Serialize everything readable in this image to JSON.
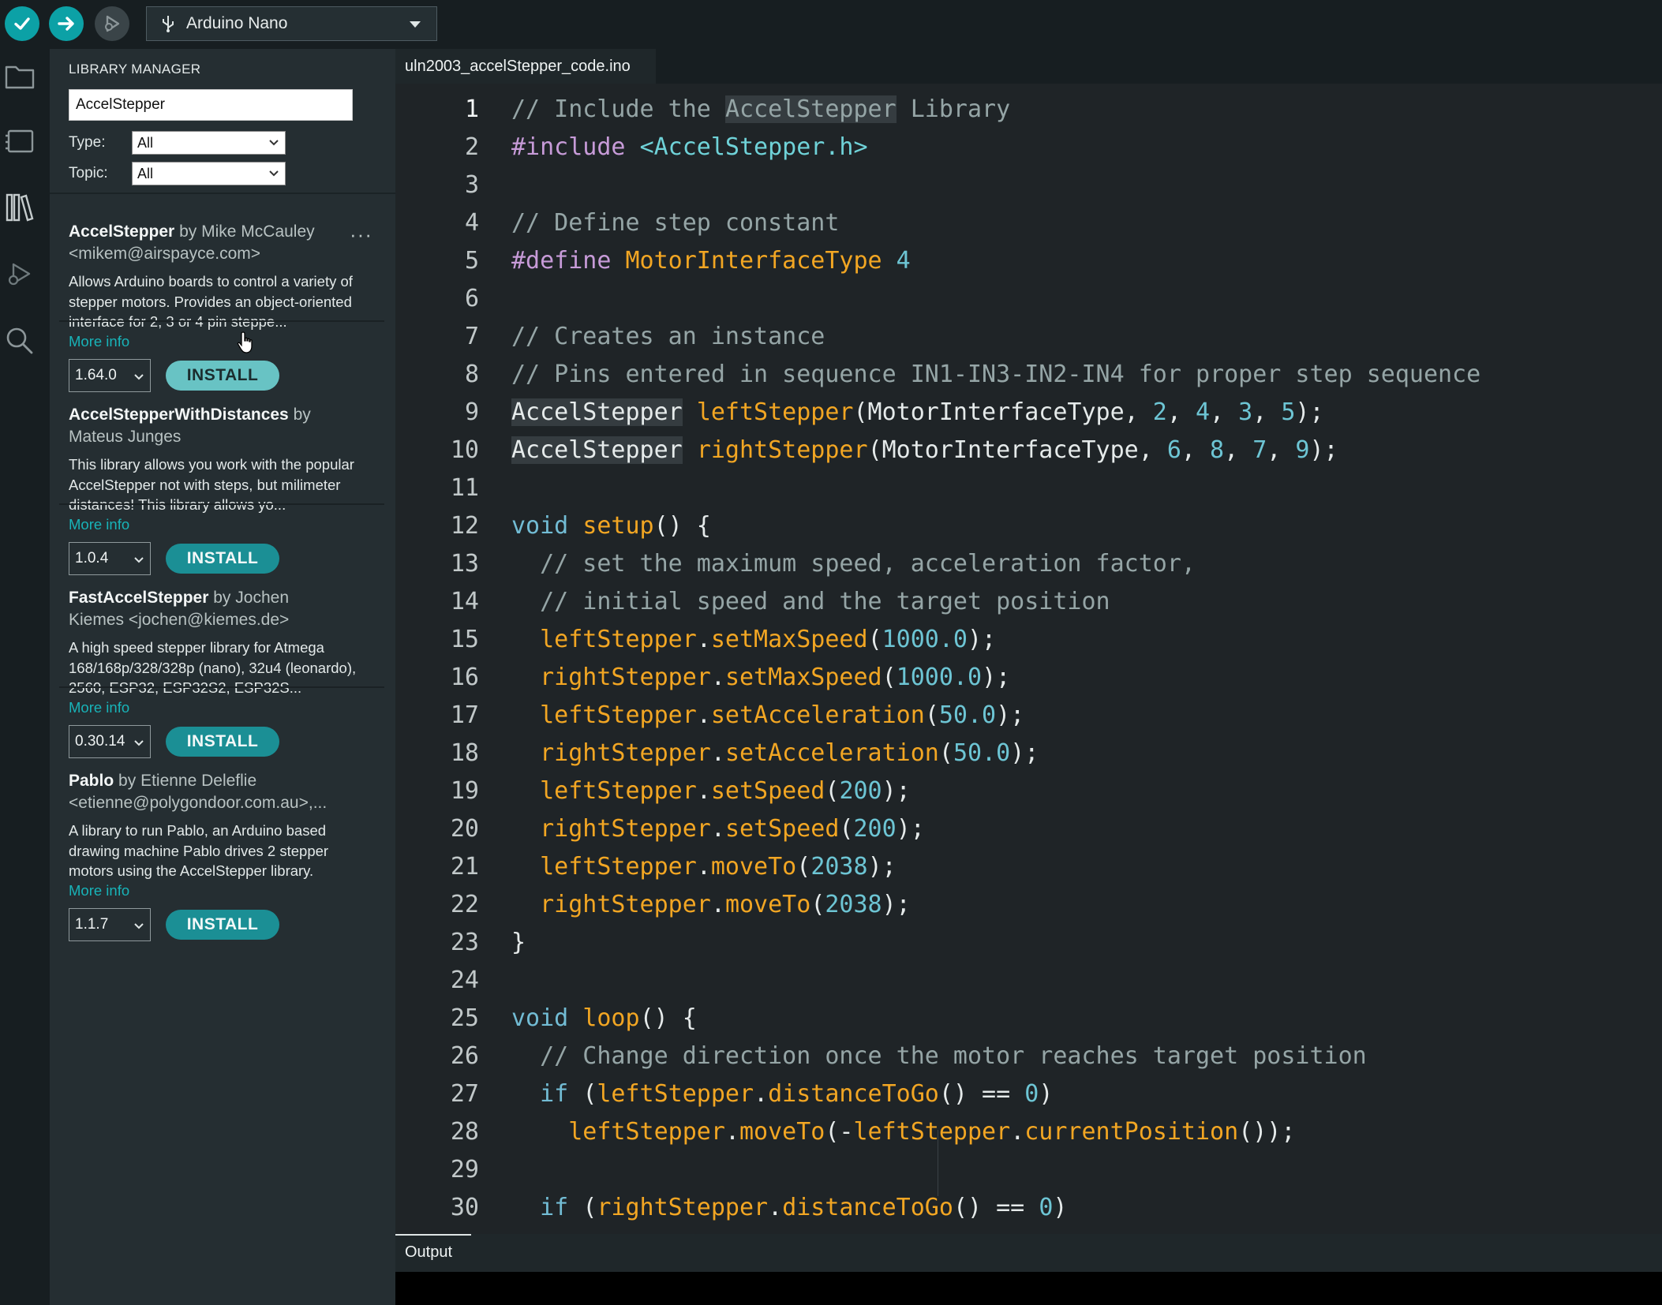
{
  "toolbar": {
    "board": "Arduino Nano"
  },
  "library_manager": {
    "title": "LIBRARY MANAGER",
    "search_value": "AccelStepper",
    "type_label": "Type:",
    "type_value": "All",
    "topic_label": "Topic:",
    "topic_value": "All",
    "libraries": [
      {
        "name": "AccelStepper",
        "by": "by",
        "author": "Mike McCauley",
        "author2": "<mikem@airspayce.com>",
        "description": "Allows Arduino boards to control a variety of stepper motors. Provides an object-oriented interface for 2, 3 or 4 pin steppe...",
        "more_info": "More info",
        "version": "1.64.0",
        "install": "INSTALL"
      },
      {
        "name": "AccelStepperWithDistances",
        "by": "by",
        "author": "",
        "author2": "Mateus Junges",
        "description": "This library allows you work with the popular AccelStepper not with steps, but milimeter distances! This library allows yo...",
        "more_info": "More info",
        "version": "1.0.4",
        "install": "INSTALL"
      },
      {
        "name": "FastAccelStepper",
        "by": "by",
        "author": "Jochen",
        "author2": "Kiemes <jochen@kiemes.de>",
        "description": "A high speed stepper library for Atmega 168/168p/328/328p (nano), 32u4 (leonardo), 2560, ESP32, ESP32S2, ESP32S...",
        "more_info": "More info",
        "version": "0.30.14",
        "install": "INSTALL"
      },
      {
        "name": "Pablo",
        "by": "by",
        "author": "Etienne Deleflie",
        "author2": "<etienne@polygondoor.com.au>,...",
        "description": "A library to run Pablo, an Arduino based drawing machine Pablo drives 2 stepper motors using the AccelStepper library.",
        "more_info": "More info",
        "version": "1.1.7",
        "install": "INSTALL"
      }
    ]
  },
  "editor": {
    "tab": "uln2003_accelStepper_code.ino",
    "lines": [
      [
        [
          "c-com",
          "// Include the "
        ],
        [
          "c-com hl",
          "AccelStepper"
        ],
        [
          "c-com",
          " Library"
        ]
      ],
      [
        [
          "c-pre",
          "#include "
        ],
        [
          "c-inc",
          "<AccelStepper.h>"
        ]
      ],
      [],
      [
        [
          "c-com",
          "// Define step constant"
        ]
      ],
      [
        [
          "c-pre",
          "#define "
        ],
        [
          "c-fn",
          "MotorInterfaceType "
        ],
        [
          "c-num",
          "4"
        ]
      ],
      [],
      [
        [
          "c-com",
          "// Creates an instance"
        ]
      ],
      [
        [
          "c-com",
          "// Pins entered in sequence IN1-IN3-IN2-IN4 for proper step sequence"
        ]
      ],
      [
        [
          "c-typ hl",
          "AccelStepper"
        ],
        [
          "c-op",
          " "
        ],
        [
          "c-fn",
          "leftStepper"
        ],
        [
          "c-op",
          "(MotorInterfaceType, "
        ],
        [
          "c-num",
          "2"
        ],
        [
          "c-op",
          ", "
        ],
        [
          "c-num",
          "4"
        ],
        [
          "c-op",
          ", "
        ],
        [
          "c-num",
          "3"
        ],
        [
          "c-op",
          ", "
        ],
        [
          "c-num",
          "5"
        ],
        [
          "c-op",
          ");"
        ]
      ],
      [
        [
          "c-typ hl",
          "AccelStepper"
        ],
        [
          "c-op",
          " "
        ],
        [
          "c-fn",
          "rightStepper"
        ],
        [
          "c-op",
          "(MotorInterfaceType, "
        ],
        [
          "c-num",
          "6"
        ],
        [
          "c-op",
          ", "
        ],
        [
          "c-num",
          "8"
        ],
        [
          "c-op",
          ", "
        ],
        [
          "c-num",
          "7"
        ],
        [
          "c-op",
          ", "
        ],
        [
          "c-num",
          "9"
        ],
        [
          "c-op",
          ");"
        ]
      ],
      [],
      [
        [
          "c-kw",
          "void "
        ],
        [
          "c-fn",
          "setup"
        ],
        [
          "c-op",
          "() {"
        ]
      ],
      [
        [
          "c-com",
          "  // set the maximum speed, acceleration factor,"
        ]
      ],
      [
        [
          "c-com",
          "  // initial speed and the target position"
        ]
      ],
      [
        [
          "c-fn",
          "  leftStepper"
        ],
        [
          "c-op",
          "."
        ],
        [
          "c-fn",
          "setMaxSpeed"
        ],
        [
          "c-op",
          "("
        ],
        [
          "c-num",
          "1000.0"
        ],
        [
          "c-op",
          ");"
        ]
      ],
      [
        [
          "c-fn",
          "  rightStepper"
        ],
        [
          "c-op",
          "."
        ],
        [
          "c-fn",
          "setMaxSpeed"
        ],
        [
          "c-op",
          "("
        ],
        [
          "c-num",
          "1000.0"
        ],
        [
          "c-op",
          ");"
        ]
      ],
      [
        [
          "c-fn",
          "  leftStepper"
        ],
        [
          "c-op",
          "."
        ],
        [
          "c-fn",
          "setAcceleration"
        ],
        [
          "c-op",
          "("
        ],
        [
          "c-num",
          "50.0"
        ],
        [
          "c-op",
          ");"
        ]
      ],
      [
        [
          "c-fn",
          "  rightStepper"
        ],
        [
          "c-op",
          "."
        ],
        [
          "c-fn",
          "setAcceleration"
        ],
        [
          "c-op",
          "("
        ],
        [
          "c-num",
          "50.0"
        ],
        [
          "c-op",
          ");"
        ]
      ],
      [
        [
          "c-fn",
          "  leftStepper"
        ],
        [
          "c-op",
          "."
        ],
        [
          "c-fn",
          "setSpeed"
        ],
        [
          "c-op",
          "("
        ],
        [
          "c-num",
          "200"
        ],
        [
          "c-op",
          ");"
        ]
      ],
      [
        [
          "c-fn",
          "  rightStepper"
        ],
        [
          "c-op",
          "."
        ],
        [
          "c-fn",
          "setSpeed"
        ],
        [
          "c-op",
          "("
        ],
        [
          "c-num",
          "200"
        ],
        [
          "c-op",
          ");"
        ]
      ],
      [
        [
          "c-fn",
          "  leftStepper"
        ],
        [
          "c-op",
          "."
        ],
        [
          "c-fn",
          "moveTo"
        ],
        [
          "c-op",
          "("
        ],
        [
          "c-num",
          "2038"
        ],
        [
          "c-op",
          ");"
        ]
      ],
      [
        [
          "c-fn",
          "  rightStepper"
        ],
        [
          "c-op",
          "."
        ],
        [
          "c-fn",
          "moveTo"
        ],
        [
          "c-op",
          "("
        ],
        [
          "c-num",
          "2038"
        ],
        [
          "c-op",
          ");"
        ]
      ],
      [
        [
          "c-op",
          "}"
        ]
      ],
      [],
      [
        [
          "c-kw",
          "void "
        ],
        [
          "c-fn",
          "loop"
        ],
        [
          "c-op",
          "() {"
        ]
      ],
      [
        [
          "c-com",
          "  // Change direction once the motor reaches target position"
        ]
      ],
      [
        [
          "c-kw",
          "  if "
        ],
        [
          "c-op",
          "("
        ],
        [
          "c-fn",
          "leftStepper"
        ],
        [
          "c-op",
          "."
        ],
        [
          "c-fn",
          "distanceToGo"
        ],
        [
          "c-op",
          "() == "
        ],
        [
          "c-num",
          "0"
        ],
        [
          "c-op",
          ")"
        ]
      ],
      [
        [
          "c-fn",
          "    leftStepper"
        ],
        [
          "c-op",
          "."
        ],
        [
          "c-fn",
          "moveTo"
        ],
        [
          "c-op",
          "(-"
        ],
        [
          "c-fn",
          "leftStepper"
        ],
        [
          "c-op",
          "."
        ],
        [
          "c-fn",
          "currentPosition"
        ],
        [
          "c-op",
          "());"
        ]
      ],
      [],
      [
        [
          "c-kw",
          "  if "
        ],
        [
          "c-op",
          "("
        ],
        [
          "c-fn",
          "rightStepper"
        ],
        [
          "c-op",
          "."
        ],
        [
          "c-fn",
          "distanceToGo"
        ],
        [
          "c-op",
          "() == "
        ],
        [
          "c-num",
          "0"
        ],
        [
          "c-op",
          ")"
        ]
      ]
    ]
  },
  "panel": {
    "output_tab": "Output"
  },
  "colors": {
    "accent": "#0ca1a6",
    "install": "#1b8f95",
    "function": "#f2a623",
    "comment": "#95a5a6",
    "number": "#6dc5d4"
  },
  "icons": [
    "check-icon",
    "arrow-right-icon",
    "debug-icon",
    "usb-icon",
    "folder-icon",
    "board-icon",
    "library-icon",
    "debug-sidebar-icon",
    "search-icon",
    "chevron-down-icon",
    "pointer-cursor-icon"
  ]
}
